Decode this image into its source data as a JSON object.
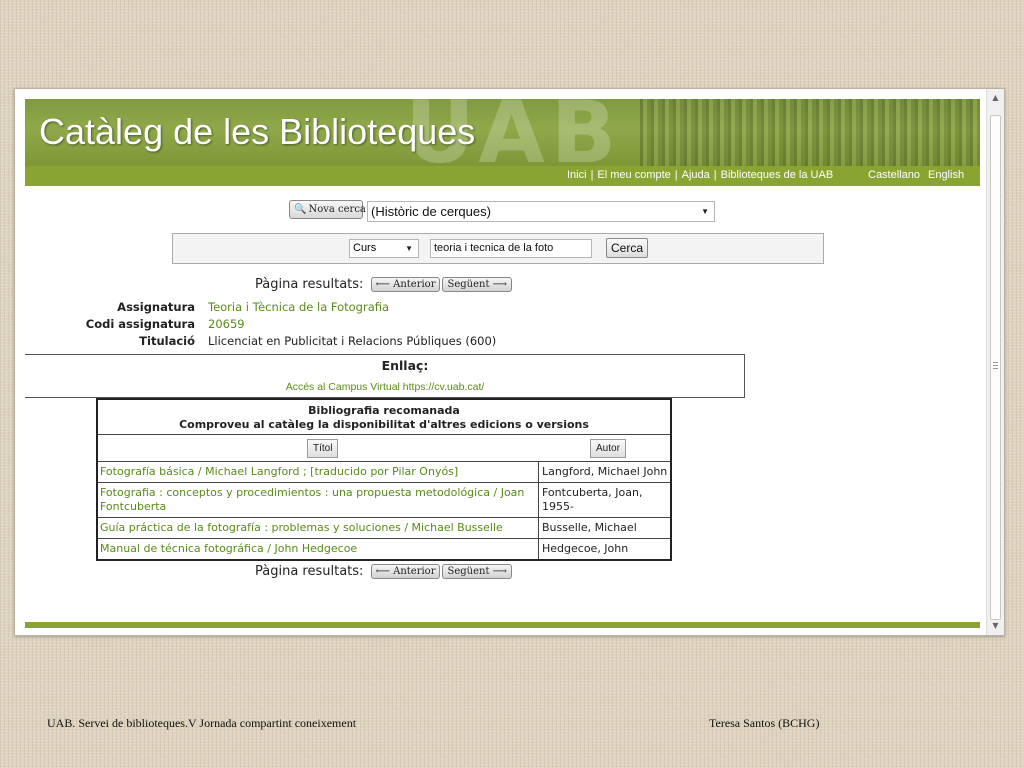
{
  "banner": {
    "title": "Catàleg de les Biblioteques",
    "logo_text": "UAB"
  },
  "nav": {
    "links": [
      "Inici",
      "El meu compte",
      "Ajuda",
      "Biblioteques de la UAB"
    ],
    "separator": "|",
    "languages": [
      "Castellano",
      "English"
    ]
  },
  "search": {
    "new_search_label": "Nova cerca",
    "history_select": "(Històric de cerques)",
    "scope_select": "Curs",
    "query_value": "teoria i tecnica de la foto",
    "submit_label": "Cerca"
  },
  "pager": {
    "label": "Pàgina resultats:",
    "prev_label": "Anterior",
    "next_label": "Següent"
  },
  "course": {
    "subject_label": "Assignatura",
    "subject_value": "Teoria i Tècnica de la Fotografia",
    "code_label": "Codi assignatura",
    "code_value": "20659",
    "degree_label": "Titulació",
    "degree_value": "Llicenciat en Publicitat i Relacions Públiques (600)"
  },
  "link_box": {
    "title": "Enllaç:",
    "url_text": "Accés al Campus Virtual https://cv.uab.cat/"
  },
  "bibliography": {
    "heading_line1": "Bibliografia recomanada",
    "heading_line2": "Comproveu al catàleg la disponibilitat d'altres edicions o versions",
    "sort_title_label": "Títol",
    "sort_author_label": "Autor",
    "rows": [
      {
        "title": "Fotografía básica / Michael Langford ; [traducido por Pilar Onyós]",
        "author": "Langford, Michael John"
      },
      {
        "title": "Fotografia : conceptos y procedimientos : una propuesta metodológica / Joan Fontcuberta",
        "author": "Fontcuberta, Joan, 1955-"
      },
      {
        "title": "Guía práctica de la fotografía : problemas y soluciones / Michael Busselle",
        "author": "Busselle, Michael"
      },
      {
        "title": "Manual de técnica fotográfica / John Hedgecoe",
        "author": "Hedgecoe, John"
      }
    ]
  },
  "slide_footer": {
    "left": "UAB. Servei de biblioteques.V Jornada compartint coneixement",
    "right": "Teresa Santos (BCHG)"
  },
  "colors": {
    "banner_green": "#8aa432",
    "link_green": "#5a8a16"
  },
  "icons": {
    "search": "magnifier-icon",
    "prev": "arrow-left-icon",
    "next": "arrow-right-icon",
    "dropdown": "triangle-down-icon"
  }
}
